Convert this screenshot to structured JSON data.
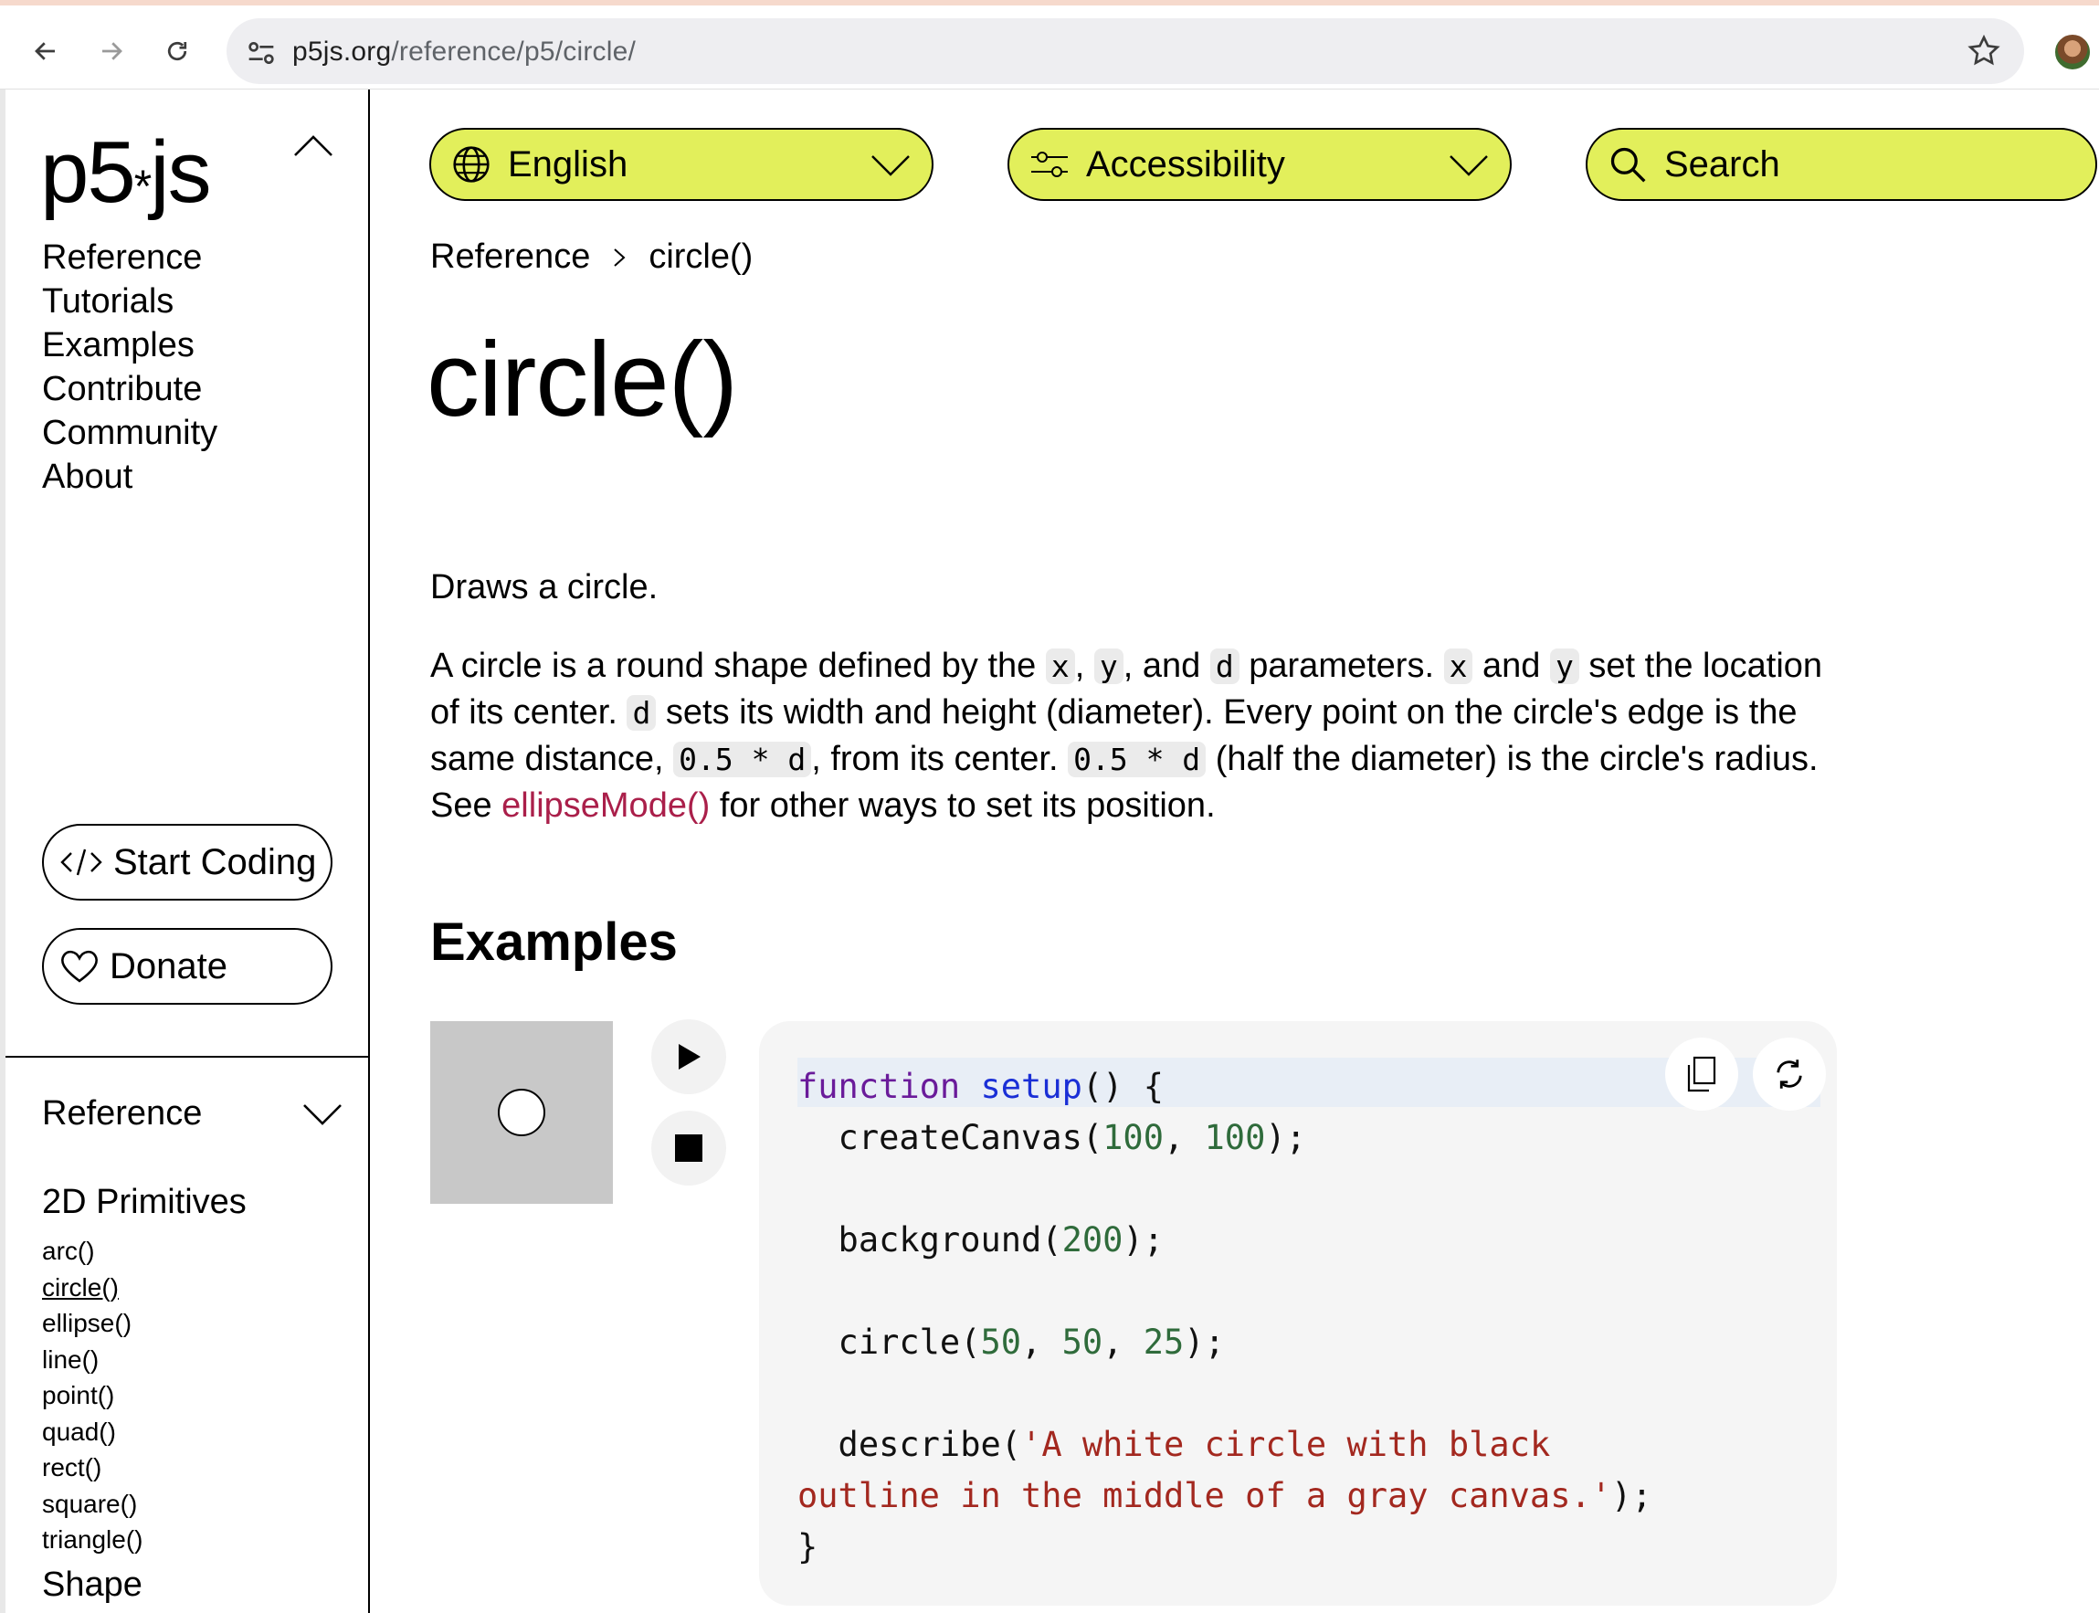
{
  "browser": {
    "url_host": "p5js.org",
    "url_path": "/reference/p5/circle/"
  },
  "sidebar": {
    "logo": "p5",
    "logo_suffix": "js",
    "nav": [
      "Reference",
      "Tutorials",
      "Examples",
      "Contribute",
      "Community",
      "About"
    ],
    "start_coding": "Start Coding",
    "donate": "Donate",
    "reference_title": "Reference",
    "group_title": "2D Primitives",
    "items": [
      "arc()",
      "circle()",
      "ellipse()",
      "line()",
      "point()",
      "quad()",
      "rect()",
      "square()",
      "triangle()"
    ],
    "active_item": "circle()",
    "next_group": "Shape"
  },
  "header": {
    "language": "English",
    "accessibility": "Accessibility",
    "search": "Search"
  },
  "breadcrumb": {
    "root": "Reference",
    "current": "circle()"
  },
  "content": {
    "title": "circle()",
    "short_description": "Draws a circle.",
    "long": {
      "t1": "A circle is a round shape defined by the ",
      "c_x": "x",
      "t2": ", ",
      "c_y": "y",
      "t3": ", and ",
      "c_d": "d",
      "t4": " parameters. ",
      "c_x2": "x",
      "t5": " and ",
      "c_y2": "y",
      "t6": " set the location of its center. ",
      "c_d2": "d",
      "t7": " sets its width and height (diameter). Every point on the circle's edge is the same distance, ",
      "c_half": "0.5 * d",
      "t8": ", from its center. ",
      "c_half2": "0.5 * d",
      "t9": " (half the diameter) is the circle's radius. See ",
      "link": "ellipseMode()",
      "t10": " for other ways to set its position."
    },
    "examples_heading": "Examples"
  },
  "code": {
    "l1_kw": "function",
    "l1_fn": "setup",
    "l1_rest": "() {",
    "l2_a": "  createCanvas(",
    "l2_n1": "100",
    "l2_b": ", ",
    "l2_n2": "100",
    "l2_c": ");",
    "l4_a": "  background(",
    "l4_n": "200",
    "l4_b": ");",
    "l6_a": "  circle(",
    "l6_n1": "50",
    "l6_b": ", ",
    "l6_n2": "50",
    "l6_c": ", ",
    "l6_n3": "25",
    "l6_d": ");",
    "l8_a": "  describe(",
    "l8_s1": "'A white circle with black",
    "l9_s2": "outline in the middle of a gray canvas.'",
    "l9_b": ");",
    "l10": "}"
  },
  "colors": {
    "accent_yellow": "#e2ef5b",
    "link": "#aa1f4a",
    "canvas_gray": "#c8c8c8"
  }
}
